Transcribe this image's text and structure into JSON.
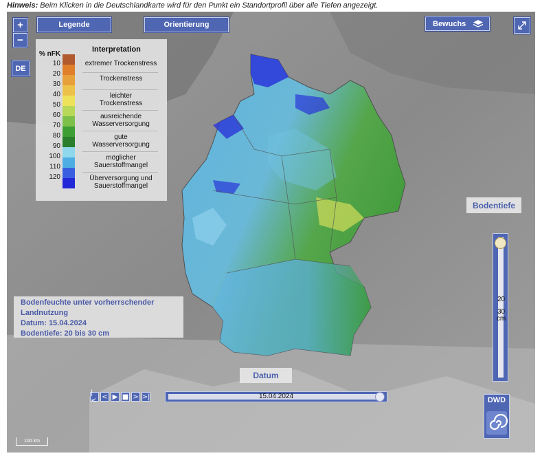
{
  "hint": {
    "label": "Hinweis:",
    "text": " Beim Klicken in die Deutschlandkarte wird für den Punkt ein Standortprofil über alle Tiefen angezeigt."
  },
  "toolbar": {
    "zoom_in": "+",
    "zoom_out": "−",
    "legend_label": "Legende",
    "orientation_label": "Orientierung",
    "bewuchs_label": "Bewuchs",
    "fullscreen_icon": "expand-icon",
    "de_label": "DE"
  },
  "legend": {
    "col1_header": "% nFK",
    "col2_header": "Interpretation",
    "scale": [
      {
        "value": "10",
        "color": "#b05a2e"
      },
      {
        "value": "20",
        "color": "#e07f2a"
      },
      {
        "value": "30",
        "color": "#e8a03a"
      },
      {
        "value": "40",
        "color": "#edc24a"
      },
      {
        "value": "50",
        "color": "#eee25a"
      },
      {
        "value": "60",
        "color": "#b8d85a"
      },
      {
        "value": "70",
        "color": "#7cc04a"
      },
      {
        "value": "80",
        "color": "#3d9e33"
      },
      {
        "value": "90",
        "color": "#2a7e2c"
      },
      {
        "value": "100",
        "color": "#8fd8ec"
      },
      {
        "value": "110",
        "color": "#4eaee4"
      },
      {
        "value": "120",
        "color": "#3a5ee0"
      },
      {
        "value": "",
        "color": "#2228d8"
      }
    ],
    "items": [
      {
        "label": "extremer Trockenstress"
      },
      {
        "label": "Trockenstress"
      },
      {
        "label": "leichter\nTrockenstress"
      },
      {
        "label": "ausreichende\nWasserversorgung"
      },
      {
        "label": "gute\nWasserversorgung"
      },
      {
        "label": "möglicher\nSauerstoffmangel"
      },
      {
        "label": "Überversorgung und\nSauerstoffmangel"
      }
    ]
  },
  "info": {
    "line1": "Bodenfeuchte unter vorherrschender",
    "line2": "Landnutzung",
    "line3": "Datum: 15.04.2024",
    "line4": "Bodentiefe: 20 bis 30 cm"
  },
  "depth": {
    "title": "Bodentiefe",
    "from": "20",
    "to": "30",
    "unit": "cm"
  },
  "date": {
    "title": "Datum",
    "value": "15.04.2024"
  },
  "playback": {
    "first": "|<",
    "prev": "<",
    "play": "▶",
    "stop": "■",
    "next": ">",
    "last": ">|"
  },
  "logo": {
    "text": "DWD"
  },
  "scalebar": {
    "label": "100 km"
  },
  "colors": {
    "accent": "#4f66b3",
    "label_text": "#4c62ad"
  }
}
